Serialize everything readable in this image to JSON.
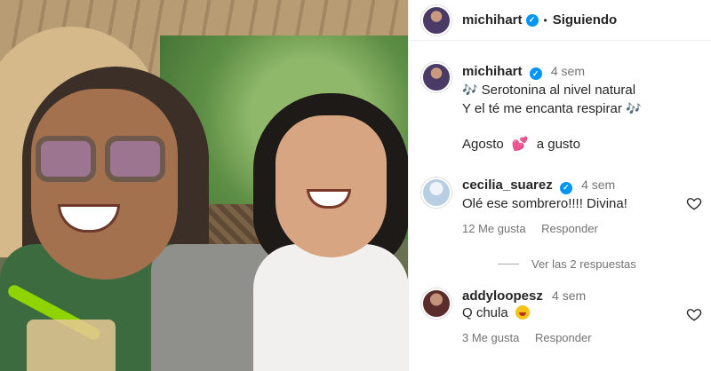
{
  "header": {
    "username": "michihart",
    "separator": "•",
    "follow_state": "Siguiendo"
  },
  "post": {
    "username": "michihart",
    "time": "4 sem",
    "line1": "Serotonina al nivel natural",
    "line2": "Y el té me encanta respirar",
    "line3_a": "Agosto",
    "line3_b": "a gusto",
    "music_icon": "🎶",
    "heart_icon": "💕"
  },
  "comments": [
    {
      "username": "cecilia_suarez",
      "time": "4 sem",
      "text": "Olé ese sombrero!!!! Divina!",
      "likes": "12 Me gusta",
      "reply": "Responder",
      "verified": true
    },
    {
      "username": "addyloopesz",
      "time": "4 sem",
      "text": "Q chula",
      "likes": "3 Me gusta",
      "reply": "Responder",
      "verified": false
    }
  ],
  "view_replies": "Ver las 2 respuestas",
  "colors": {
    "verified": "#0095f6",
    "muted": "#737373",
    "text": "#262626"
  }
}
